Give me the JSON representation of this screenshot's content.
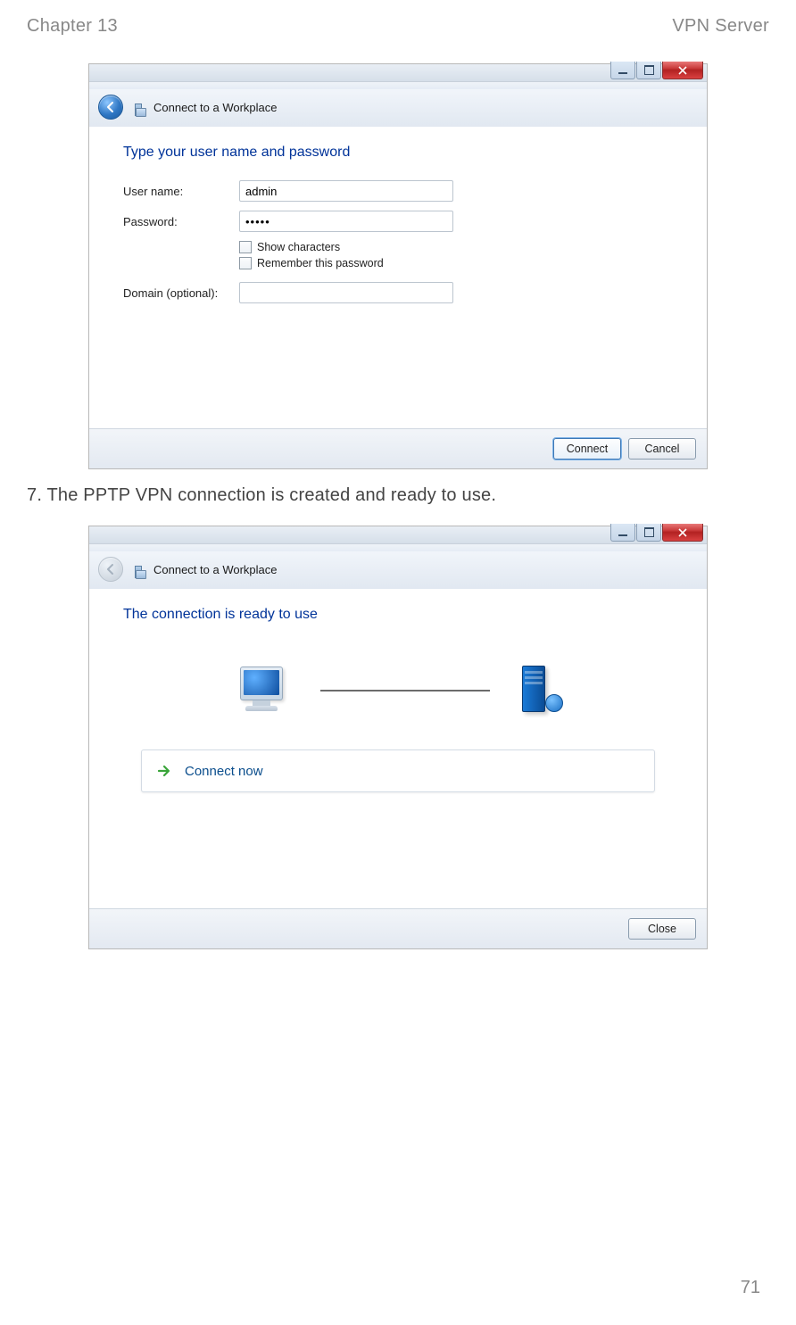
{
  "doc": {
    "chapter": "Chapter 13",
    "title": "VPN Server",
    "page_num": "71"
  },
  "win1": {
    "nav_title": "Connect to a Workplace",
    "heading": "Type your user name and password",
    "username_label": "User name:",
    "username_value": "admin",
    "password_label": "Password:",
    "password_value": "•••••",
    "show_chars": "Show characters",
    "remember": "Remember this password",
    "domain_label": "Domain (optional):",
    "domain_value": "",
    "connect": "Connect",
    "cancel": "Cancel"
  },
  "caption": "7. The PPTP VPN connection is created and ready to use.",
  "win2": {
    "nav_title": "Connect to a Workplace",
    "heading": "The connection is ready to use",
    "connect_now": "Connect now",
    "close": "Close"
  }
}
